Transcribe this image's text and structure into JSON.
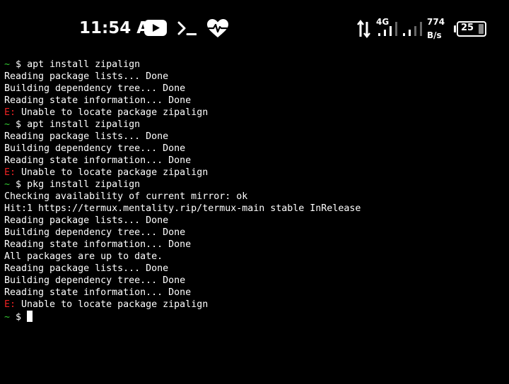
{
  "status_bar": {
    "time": "11:54 AM",
    "network_type": "4G",
    "speed_value": "774",
    "speed_unit": "B/s",
    "battery_level": "25",
    "icons": [
      "youtube-icon",
      "terminal-icon",
      "heart-rate-icon",
      "data-transfer-icon",
      "signal-strength-icon",
      "battery-icon"
    ]
  },
  "terminal": {
    "prompt_symbol": "~",
    "prompt_char": "$",
    "error_tag": "E:",
    "colors": {
      "background": "#000000",
      "text": "#ffffff",
      "prompt": "#33cc33",
      "error": "#ee2222"
    },
    "lines": [
      {
        "type": "prompt",
        "text": "apt install zipalign"
      },
      {
        "type": "output",
        "text": "Reading package lists... Done"
      },
      {
        "type": "output",
        "text": "Building dependency tree... Done"
      },
      {
        "type": "output",
        "text": "Reading state information... Done"
      },
      {
        "type": "error",
        "text": "Unable to locate package zipalign"
      },
      {
        "type": "prompt",
        "text": "apt install zipalign"
      },
      {
        "type": "output",
        "text": "Reading package lists... Done"
      },
      {
        "type": "output",
        "text": "Building dependency tree... Done"
      },
      {
        "type": "output",
        "text": "Reading state information... Done"
      },
      {
        "type": "error",
        "text": "Unable to locate package zipalign"
      },
      {
        "type": "prompt",
        "text": "pkg install zipalign"
      },
      {
        "type": "output",
        "text": "Checking availability of current mirror: ok"
      },
      {
        "type": "output",
        "text": "Hit:1 https://termux.mentality.rip/termux-main stable InRelease"
      },
      {
        "type": "output",
        "text": "Reading package lists... Done"
      },
      {
        "type": "output",
        "text": "Building dependency tree... Done"
      },
      {
        "type": "output",
        "text": "Reading state information... Done"
      },
      {
        "type": "output",
        "text": "All packages are up to date."
      },
      {
        "type": "output",
        "text": "Reading package lists... Done"
      },
      {
        "type": "output",
        "text": "Building dependency tree... Done"
      },
      {
        "type": "output",
        "text": "Reading state information... Done"
      },
      {
        "type": "error",
        "text": "Unable to locate package zipalign"
      },
      {
        "type": "prompt",
        "text": ""
      }
    ]
  }
}
